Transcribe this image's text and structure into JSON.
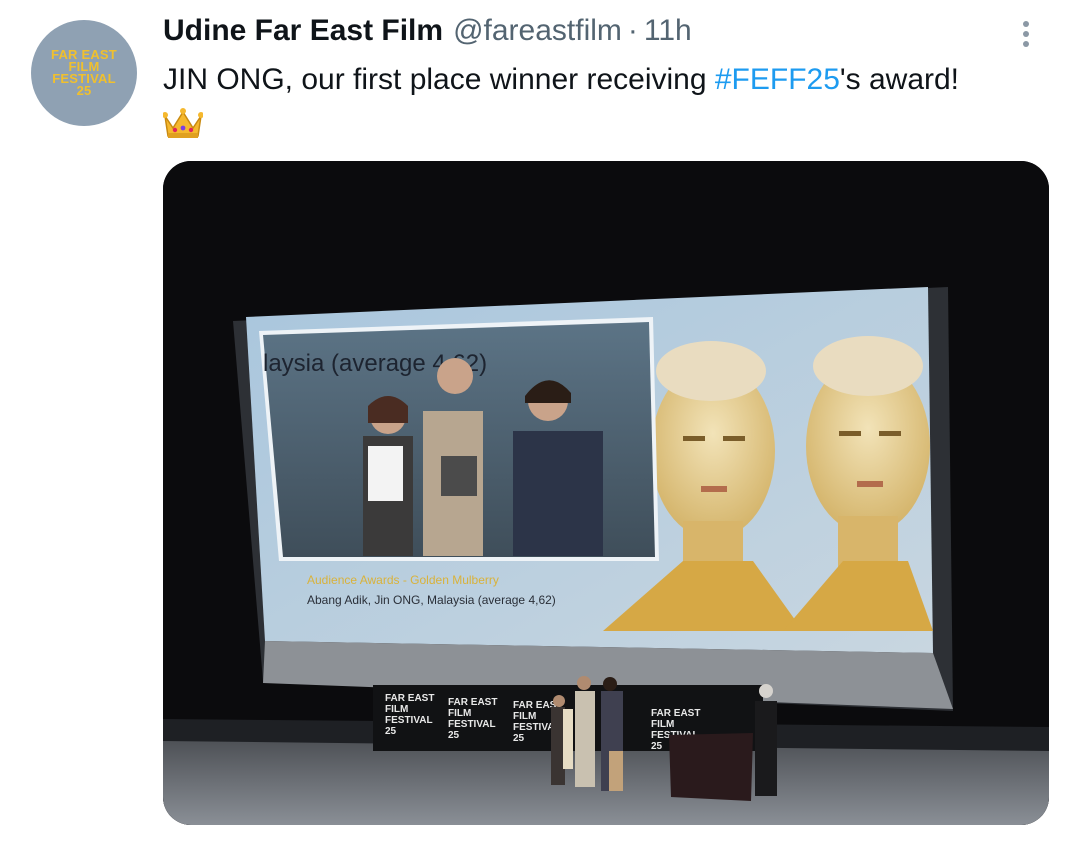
{
  "author": {
    "avatar_lines": [
      "FAR EAST",
      "FILM",
      "FESTIVAL",
      "25"
    ],
    "display_name": "Udine Far East Film",
    "handle": "@fareastfilm",
    "separator": "·",
    "timestamp": "11h"
  },
  "tweet": {
    "text_before": "JIN ONG, our first place winner receiving ",
    "hashtag": "#FEFF25",
    "text_after": "'s award!",
    "emoji": "crown"
  },
  "media": {
    "screen_top_text": "laysia (average 4,62)",
    "award_title": "Audience Awards - Golden Mulberry",
    "award_detail": "Abang Adik, Jin ONG, Malaysia (average 4,62)",
    "banner_lines": [
      "FAR EAST",
      "FILM",
      "FESTIVAL",
      "25"
    ]
  },
  "colors": {
    "hashtag": "#1d9bf0",
    "secondary_text": "#536471",
    "avatar_bg": "#8fa1b3",
    "avatar_text": "#f0c02e"
  }
}
